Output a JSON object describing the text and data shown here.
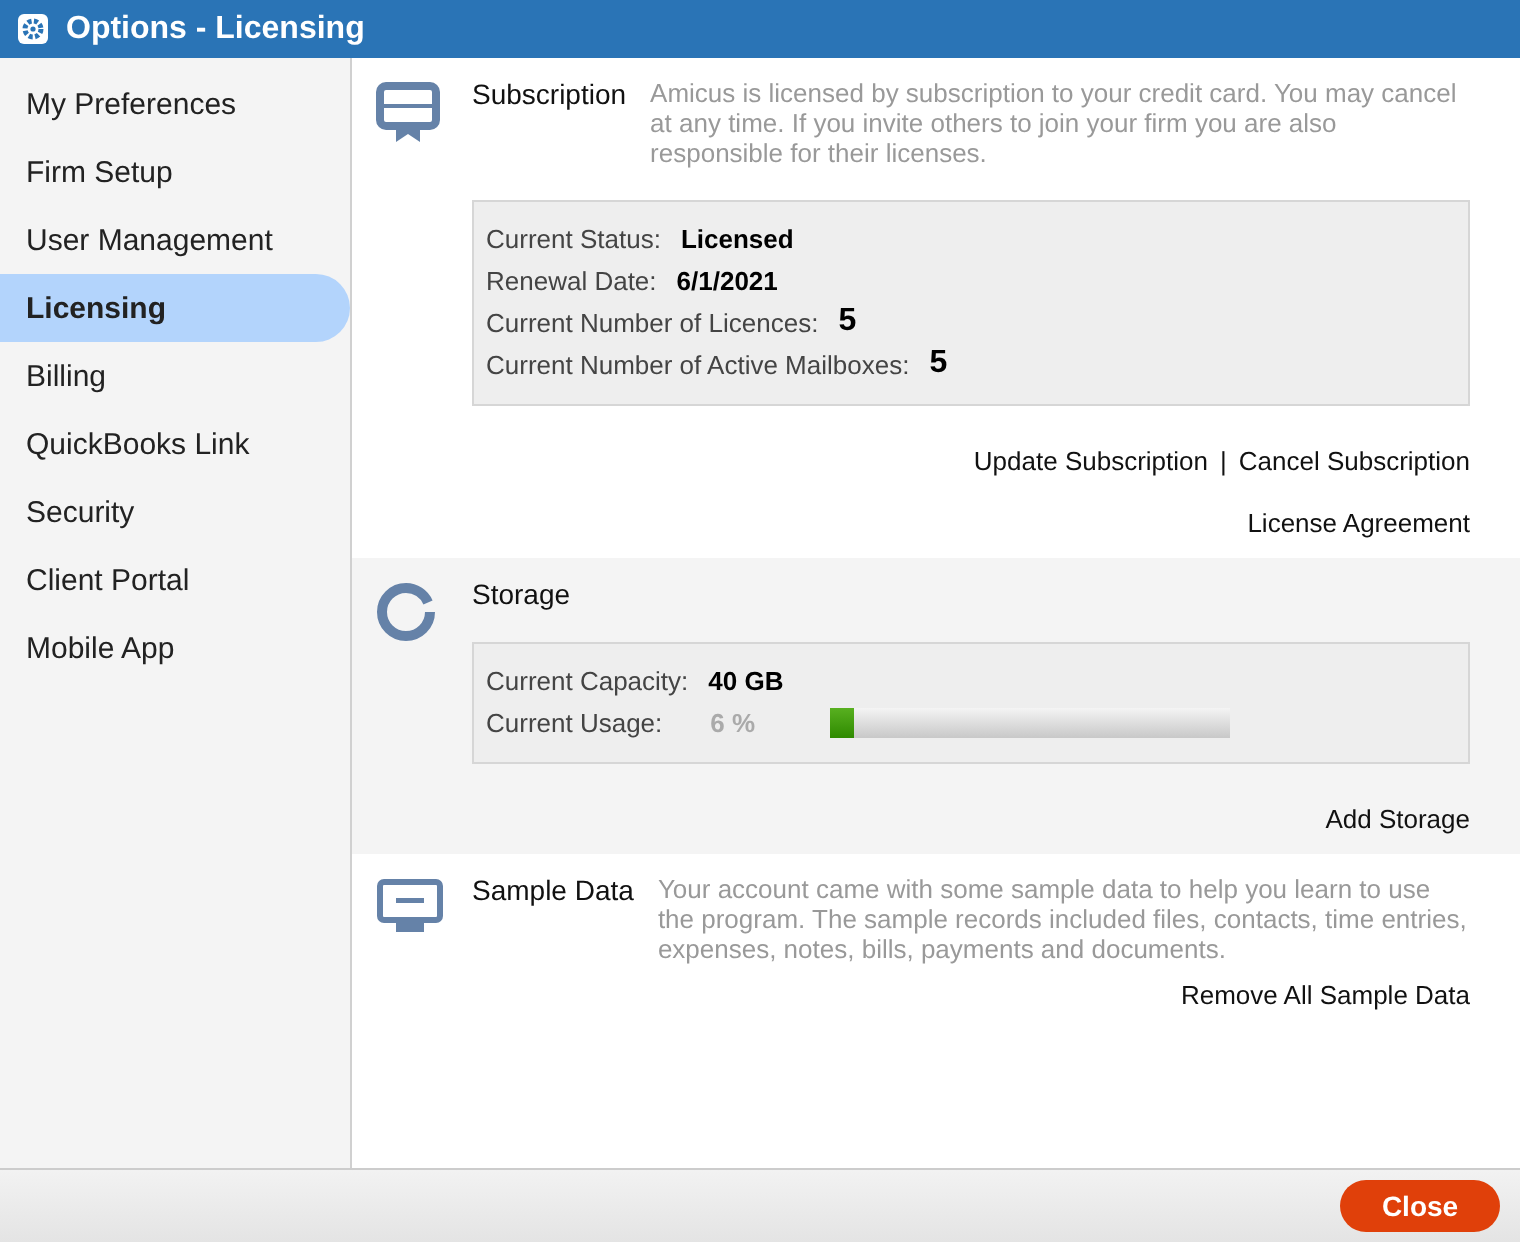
{
  "window": {
    "title": "Options - Licensing"
  },
  "sidebar": {
    "items": [
      {
        "label": "My Preferences",
        "selected": false
      },
      {
        "label": "Firm Setup",
        "selected": false
      },
      {
        "label": "User Management",
        "selected": false
      },
      {
        "label": "Licensing",
        "selected": true
      },
      {
        "label": "Billing",
        "selected": false
      },
      {
        "label": "QuickBooks Link",
        "selected": false
      },
      {
        "label": "Security",
        "selected": false
      },
      {
        "label": "Client Portal",
        "selected": false
      },
      {
        "label": "Mobile App",
        "selected": false
      }
    ]
  },
  "sections": [
    {
      "kind": "subscription",
      "title": "Subscription",
      "description": "Amicus is licensed by subscription to your credit card. You may cancel at any time. If you invite others to join your firm you are also responsible for their licenses.",
      "details": [
        {
          "kind": "text",
          "label": "Current Status:",
          "value": "Licensed"
        },
        {
          "kind": "text",
          "label": "Renewal Date:",
          "value": "6/1/2021"
        },
        {
          "kind": "count",
          "label": "Current Number of Licences:",
          "value": "5"
        },
        {
          "kind": "count",
          "label": "Current Number of Active Mailboxes:",
          "value": "5"
        }
      ],
      "link_rows": [
        {
          "links": [
            "Update Subscription",
            "Cancel Subscription"
          ],
          "separator": "|"
        },
        {
          "links": [
            "License Agreement"
          ]
        }
      ]
    },
    {
      "kind": "storage",
      "title": "Storage",
      "details": [
        {
          "kind": "text",
          "label": "Current Capacity:",
          "value": "40 GB"
        },
        {
          "kind": "meter",
          "label": "Current Usage:",
          "value": "6 %",
          "level": 0.06
        }
      ],
      "link_rows": [
        {
          "links": [
            "Add Storage"
          ]
        }
      ]
    },
    {
      "kind": "sample",
      "title": "Sample Data",
      "description": "Your account came with some sample data to help you learn to use the program. The sample records included files, contacts, time entries, expenses, notes, bills, payments and documents.",
      "link_rows": [
        {
          "links": [
            "Remove All Sample Data"
          ]
        }
      ]
    }
  ],
  "footer": {
    "button": "Close"
  }
}
